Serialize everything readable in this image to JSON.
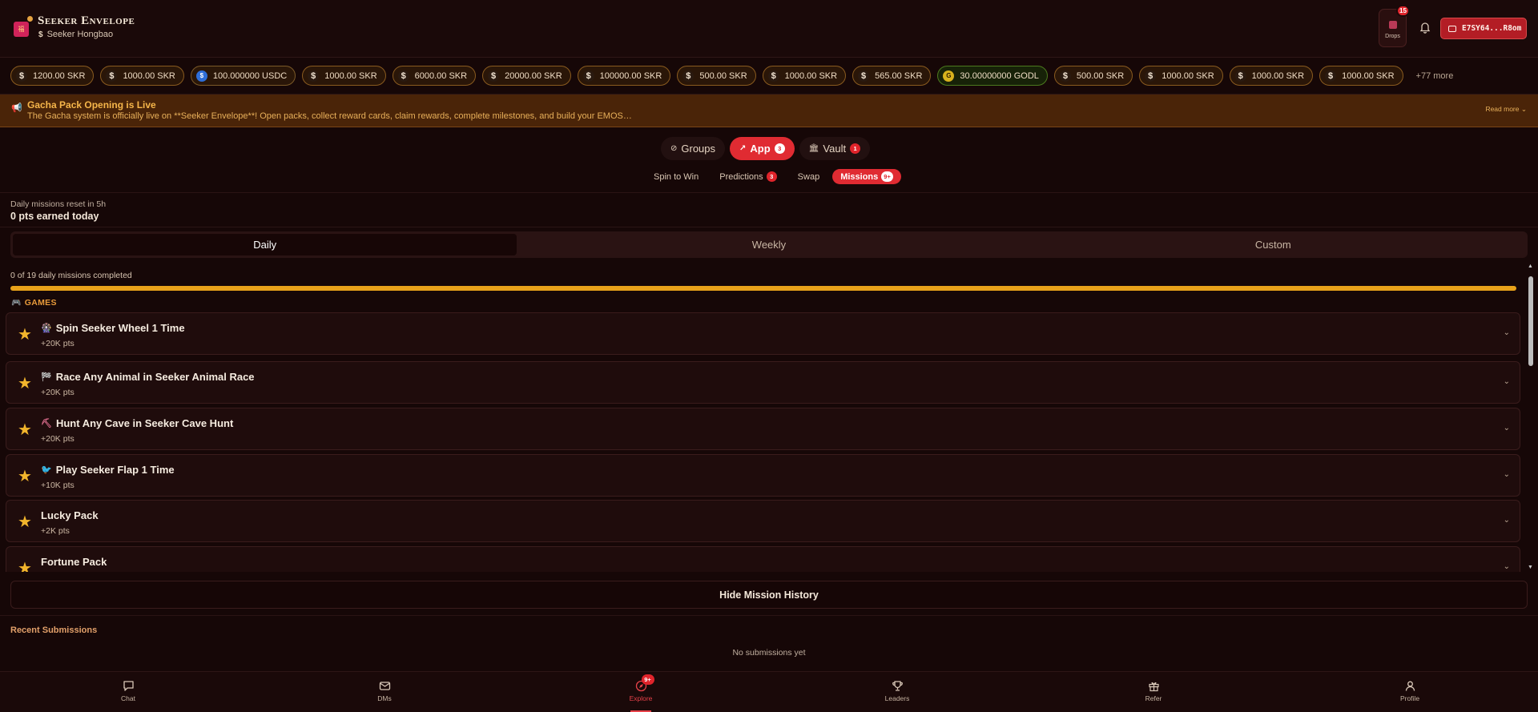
{
  "app": {
    "name": "Seeker Envelope",
    "subtitle": "Seeker Hongbao"
  },
  "header": {
    "drops_label": "Drops",
    "drops_badge": "15",
    "wallet_address": "E7SY64...R8om"
  },
  "tokens": [
    {
      "amount": "1200.00 SKR",
      "icon": "skr-icon"
    },
    {
      "amount": "1000.00 SKR",
      "icon": "skr-icon"
    },
    {
      "amount": "100.000000 USDC",
      "icon": "usdc-icon"
    },
    {
      "amount": "1000.00 SKR",
      "icon": "skr-icon"
    },
    {
      "amount": "6000.00 SKR",
      "icon": "skr-icon"
    },
    {
      "amount": "20000.00 SKR",
      "icon": "skr-icon"
    },
    {
      "amount": "100000.00 SKR",
      "icon": "skr-icon"
    },
    {
      "amount": "500.00 SKR",
      "icon": "skr-icon"
    },
    {
      "amount": "1000.00 SKR",
      "icon": "skr-icon"
    },
    {
      "amount": "565.00 SKR",
      "icon": "skr-icon"
    },
    {
      "amount": "30.00000000 GODL",
      "icon": "godl-icon"
    },
    {
      "amount": "500.00 SKR",
      "icon": "skr-icon"
    },
    {
      "amount": "1000.00 SKR",
      "icon": "skr-icon"
    },
    {
      "amount": "1000.00 SKR",
      "icon": "skr-icon"
    },
    {
      "amount": "1000.00 SKR",
      "icon": "skr-icon"
    }
  ],
  "tokens_more": "+77 more",
  "announcement": {
    "title": "Gacha Pack Opening is Live",
    "body": "The Gacha system is officially live on **Seeker Envelope**! Open packs, collect reward cards, claim rewards, complete milestones, and build your EMOS…",
    "read_more": "Read more"
  },
  "primary_tabs": [
    {
      "label": "Groups",
      "badge": "",
      "active": false
    },
    {
      "label": "App",
      "badge": "3",
      "active": true
    },
    {
      "label": "Vault",
      "badge": "1",
      "active": false
    }
  ],
  "secondary_tabs": [
    {
      "label": "Spin to Win",
      "badge": ""
    },
    {
      "label": "Predictions",
      "badge": "3"
    },
    {
      "label": "Swap",
      "badge": ""
    },
    {
      "label": "Missions",
      "badge": "9+"
    }
  ],
  "summary": {
    "reset": "Daily missions reset in 5h",
    "earned": "0 pts earned today"
  },
  "period_tabs": [
    "Daily",
    "Weekly",
    "Custom"
  ],
  "progress": {
    "text": "0 of 19 daily missions completed",
    "fraction": 1.0
  },
  "section": "GAMES",
  "missions": [
    {
      "emoji": "🎡",
      "title": "Spin Seeker Wheel 1 Time",
      "pts": "+20K pts"
    },
    {
      "emoji": "🏁",
      "title": "Race Any Animal in Seeker Animal Race",
      "pts": "+20K pts"
    },
    {
      "emoji": "⛏",
      "title": "Hunt Any Cave in Seeker Cave Hunt",
      "pts": "+20K pts"
    },
    {
      "emoji": "🐦",
      "title": "Play Seeker Flap 1 Time",
      "pts": "+10K pts"
    },
    {
      "emoji": "",
      "title": "Lucky Pack",
      "pts": "+2K pts"
    },
    {
      "emoji": "",
      "title": "Fortune Pack",
      "pts": ""
    }
  ],
  "history_button": "Hide Mission History",
  "recent": {
    "title": "Recent Submissions",
    "empty": "No submissions yet"
  },
  "nav": [
    {
      "label": "Chat",
      "icon": "chat-icon"
    },
    {
      "label": "DMs",
      "icon": "mail-icon"
    },
    {
      "label": "Explore",
      "icon": "compass-icon",
      "badge": "9+"
    },
    {
      "label": "Leaders",
      "icon": "trophy-icon"
    },
    {
      "label": "Refer",
      "icon": "gift-icon"
    },
    {
      "label": "Profile",
      "icon": "user-icon"
    }
  ],
  "colors": {
    "accent": "#e02b32",
    "gold": "#e9a21a",
    "background": "#160707"
  }
}
